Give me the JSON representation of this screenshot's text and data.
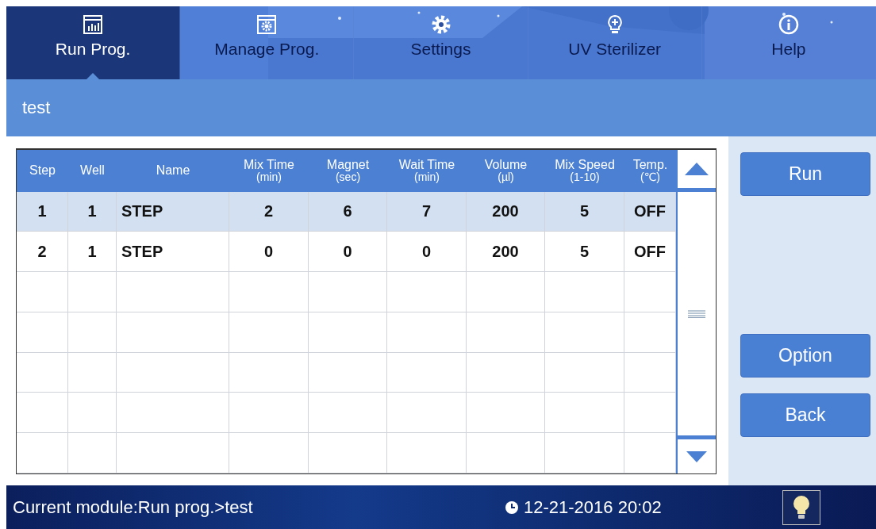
{
  "tabs": [
    {
      "label": "Run Prog.",
      "selected": true
    },
    {
      "label": "Manage Prog.",
      "selected": false
    },
    {
      "label": "Settings",
      "selected": false
    },
    {
      "label": "UV Sterilizer",
      "selected": false
    },
    {
      "label": "Help",
      "selected": false
    }
  ],
  "title": "test",
  "table": {
    "columns": [
      {
        "label": "Step"
      },
      {
        "label": "Well"
      },
      {
        "label": "Name"
      },
      {
        "label": "Mix Time",
        "unit": "(min)"
      },
      {
        "label": "Magnet",
        "unit": "(sec)"
      },
      {
        "label": "Wait Time",
        "unit": "(min)"
      },
      {
        "label": "Volume",
        "unit": "(µl)"
      },
      {
        "label": "Mix Speed",
        "unit": "(1-10)"
      },
      {
        "label": "Temp.",
        "unit": "(℃)"
      }
    ],
    "rows": [
      {
        "cells": [
          "1",
          "1",
          "STEP",
          "2",
          "6",
          "7",
          "200",
          "5",
          "OFF"
        ],
        "selected": true
      },
      {
        "cells": [
          "2",
          "1",
          "STEP",
          "0",
          "0",
          "0",
          "200",
          "5",
          "OFF"
        ],
        "selected": false
      }
    ]
  },
  "buttons": [
    {
      "label": "Run",
      "kind": "top"
    },
    {
      "label": "Option",
      "kind": "bottom"
    },
    {
      "label": "Back",
      "kind": "bottom"
    }
  ],
  "status_bar": {
    "module": "Current module:Run prog.>test",
    "datetime": "12-21-2016 20:02"
  }
}
